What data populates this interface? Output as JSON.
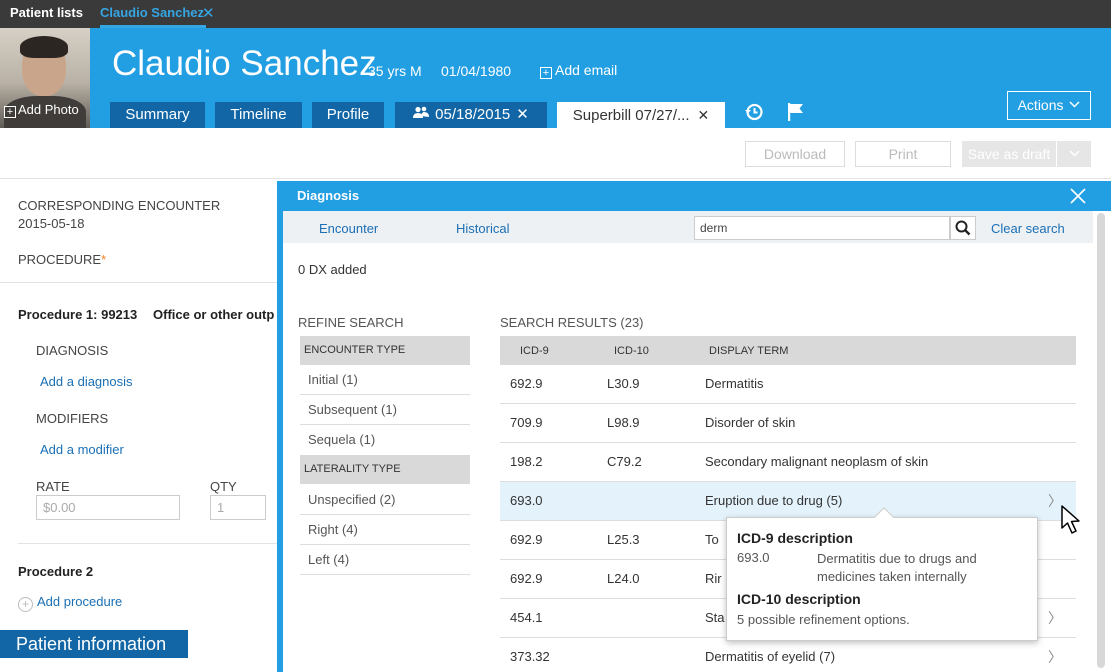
{
  "top_tabs": {
    "patient_lists": "Patient lists",
    "patient": "Claudio Sanchez",
    "close": "✕"
  },
  "patient": {
    "add_photo": "Add Photo",
    "name": "Claudio Sanchez",
    "age_sex": "35 yrs M",
    "dob": "01/04/1980",
    "add_email": "Add email"
  },
  "nav": {
    "summary": "Summary",
    "timeline": "Timeline",
    "profile": "Profile",
    "encounter": "05/18/2015",
    "superbill": "Superbill 07/27/...",
    "close": "✕",
    "actions": "Actions"
  },
  "toolbar": {
    "download": "Download",
    "print": "Print",
    "save_draft": "Save as draft"
  },
  "left": {
    "enc_label": "CORRESPONDING ENCOUNTER",
    "enc_date": "2015-05-18",
    "procedure_label": "PROCEDURE",
    "required_mark": "*",
    "procedure1": "Procedure 1: 99213",
    "procedure1_desc": "Office or other outp",
    "diagnosis_label": "DIAGNOSIS",
    "add_diagnosis": "Add a diagnosis",
    "modifiers_label": "MODIFIERS",
    "add_modifier": "Add a modifier",
    "rate_label": "RATE",
    "rate_placeholder": "$0.00",
    "qty_label": "QTY",
    "qty_placeholder": "1",
    "procedure2": "Procedure 2",
    "add_procedure": "Add procedure",
    "patient_information": "Patient information"
  },
  "diagnosis_panel": {
    "title": "Diagnosis",
    "tab_encounter": "Encounter",
    "tab_historical": "Historical",
    "search_value": "derm",
    "clear_search": "Clear search",
    "dx_count": "0 DX added",
    "refine_title": "REFINE SEARCH",
    "refine": [
      {
        "group": "ENCOUNTER TYPE",
        "items": [
          "Initial (1)",
          "Subsequent (1)",
          "Sequela (1)"
        ]
      },
      {
        "group": "LATERALITY TYPE",
        "items": [
          "Unspecified (2)",
          "Right (4)",
          "Left (4)"
        ]
      }
    ],
    "results_title": "SEARCH RESULTS (23)",
    "columns": [
      "ICD-9",
      "ICD-10",
      "DISPLAY TERM"
    ],
    "rows": [
      {
        "icd9": "692.9",
        "icd10": "L30.9",
        "term": "Dermatitis",
        "chev": ""
      },
      {
        "icd9": "709.9",
        "icd10": "L98.9",
        "term": "Disorder of skin",
        "chev": ""
      },
      {
        "icd9": "198.2",
        "icd10": "C79.2",
        "term": "Secondary malignant neoplasm of skin",
        "chev": ""
      },
      {
        "icd9": "693.0",
        "icd10": "",
        "term": "Eruption due to drug (5)",
        "chev": "〉"
      },
      {
        "icd9": "692.9",
        "icd10": "L25.3",
        "term": "To",
        "chev": ""
      },
      {
        "icd9": "692.9",
        "icd10": "L24.0",
        "term": "Rir",
        "chev": ""
      },
      {
        "icd9": "454.1",
        "icd10": "",
        "term": "Sta",
        "chev": "〉"
      },
      {
        "icd9": "373.32",
        "icd10": "",
        "term": "Dermatitis of eyelid (7)",
        "chev": "〉"
      }
    ],
    "tooltip": {
      "icd9_title": "ICD-9 description",
      "icd9_code": "693.0",
      "icd9_desc": "Dermatitis due to drugs and medicines taken internally",
      "icd10_title": "ICD-10 description",
      "icd10_desc": "5 possible refinement options."
    }
  },
  "colors": {
    "header_blue": "#229ee2",
    "tab_dark_blue": "#1366a6",
    "topbar": "#3a3a3a",
    "link": "#1a6fb5",
    "required": "#f58220"
  }
}
